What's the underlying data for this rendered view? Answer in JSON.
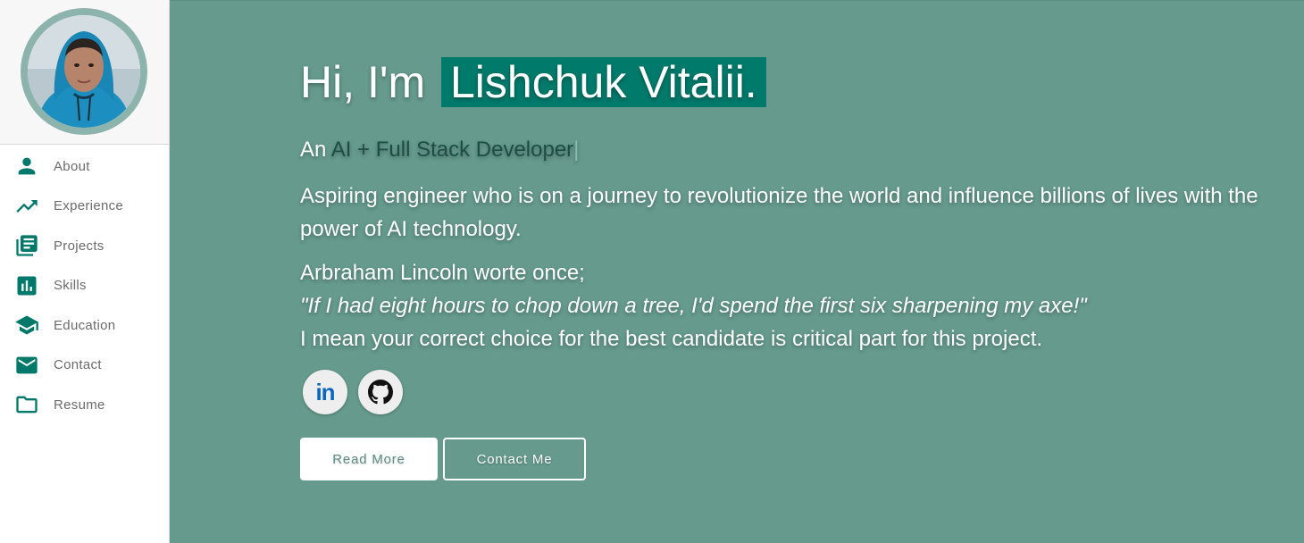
{
  "colors": {
    "background": "#659a8c",
    "accent": "#007a6b",
    "sidebar_icon": "#00796b",
    "role_text": "#1e4d45"
  },
  "sidebar": {
    "items": [
      {
        "label": "About",
        "icon": "person-icon"
      },
      {
        "label": "Experience",
        "icon": "trending-up-icon"
      },
      {
        "label": "Projects",
        "icon": "library-books-icon"
      },
      {
        "label": "Skills",
        "icon": "bar-chart-icon"
      },
      {
        "label": "Education",
        "icon": "school-icon"
      },
      {
        "label": "Contact",
        "icon": "mail-icon"
      },
      {
        "label": "Resume",
        "icon": "folder-icon"
      }
    ]
  },
  "hero": {
    "greeting": "Hi, I'm",
    "name": "Lishchuk Vitalii.",
    "tagline_prefix": "An",
    "role": "AI + Full Stack Developer",
    "cursor": "|",
    "bio": "Aspiring engineer who is on a journey to revolutionize the world and influence billions of lives with the power of AI technology.",
    "quote_intro": "Arbraham Lincoln worte once;",
    "quote": "\"If I had eight hours to chop down a tree, I'd spend the first six sharpening my axe!\"",
    "quote_outro": "I mean your correct choice for the best candidate is critical part for this project."
  },
  "socials": [
    {
      "name": "linkedin-icon",
      "text": "in"
    },
    {
      "name": "github-icon"
    }
  ],
  "buttons": {
    "read_more": "Read More",
    "contact_me": "Contact Me"
  }
}
